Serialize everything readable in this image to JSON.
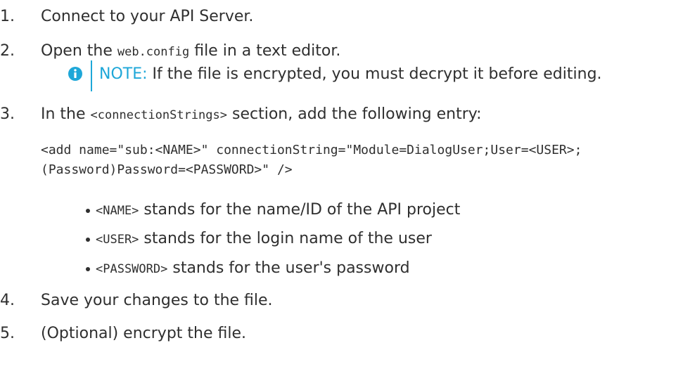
{
  "steps": [
    {
      "number": "1.",
      "text": "Connect to your API Server."
    },
    {
      "number": "2.",
      "text_before": "Open the ",
      "code": "web.config",
      "text_after": " file in a text editor."
    },
    {
      "number": "3.",
      "text_before": "In the ",
      "code": "<connectionStrings>",
      "text_after": " section, add the following entry:"
    },
    {
      "number": "4.",
      "text": "Save your changes to the file."
    },
    {
      "number": "5.",
      "text": "(Optional) encrypt the file."
    }
  ],
  "note": {
    "label": "NOTE:",
    "text": " If the file is encrypted, you must decrypt it before editing.",
    "icon": "info-icon",
    "accent_color": "#1ea7d8"
  },
  "code_block": {
    "line1": "<add name=\"sub:<NAME>\" connectionString=\"Module=DialogUser;User=<USER>;",
    "line2": "(Password)Password=<PASSWORD>\" />"
  },
  "bullets": [
    {
      "code": "<NAME>",
      "text": " stands for the name/ID of the API project"
    },
    {
      "code": "<USER>",
      "text": " stands for the login name of the user"
    },
    {
      "code": "<PASSWORD>",
      "text": " stands for the user's password"
    }
  ]
}
